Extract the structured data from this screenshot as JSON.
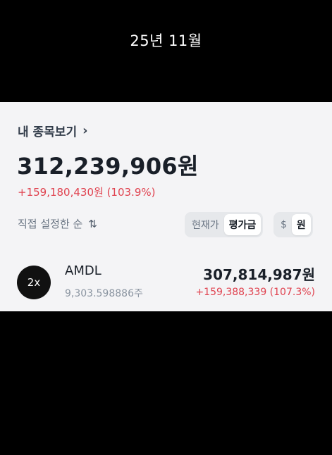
{
  "caption": "25년 11월",
  "card": {
    "header_label": "내 종목보기",
    "header_chevron": "›",
    "total_value": "312,239,906원",
    "total_gain": "+159,180,430원 (103.9%)",
    "sort_label": "직접 설정한 순",
    "sort_icon": "⇅",
    "price_toggle": {
      "option1": "현재가",
      "option2": "평가금",
      "active": "평가금"
    },
    "currency_toggle": {
      "option1": "$",
      "option2": "원",
      "active": "원"
    }
  },
  "holdings": [
    {
      "badge": "2x",
      "ticker": "AMDL",
      "shares": "9,303.598886주",
      "value": "307,814,987원",
      "gain": "+159,388,339 (107.3%)"
    }
  ],
  "colors": {
    "gain": "#e0424f",
    "card_bg": "#f4f4f6",
    "text_primary": "#191f28"
  }
}
